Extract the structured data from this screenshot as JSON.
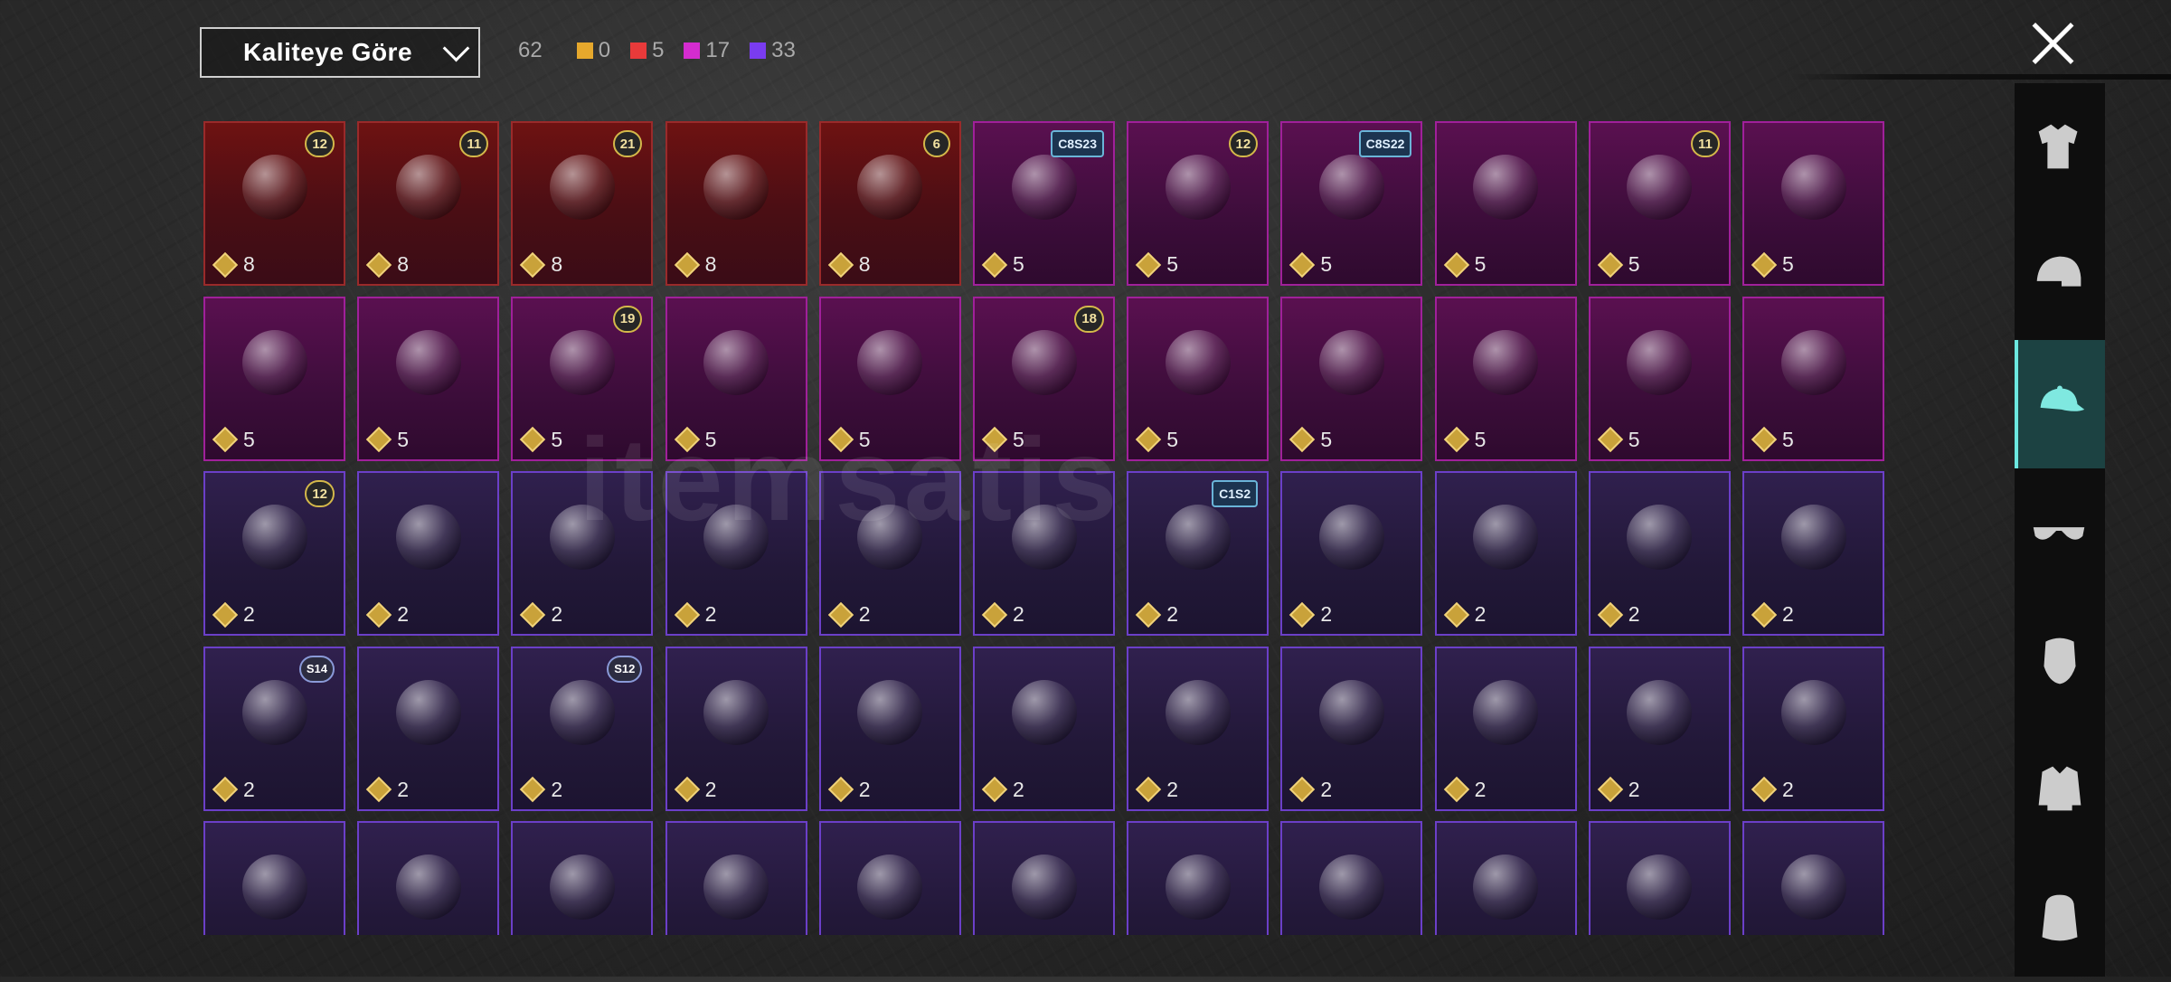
{
  "sort_dropdown": {
    "label": "Kaliteye Göre"
  },
  "quality_counts": {
    "total": "62",
    "items": [
      {
        "color": "#e6a82c",
        "count": "0"
      },
      {
        "color": "#e83a3a",
        "count": "5"
      },
      {
        "color": "#d42ccf",
        "count": "17"
      },
      {
        "color": "#7a3cf0",
        "count": "33"
      }
    ]
  },
  "watermark": "itemsatis",
  "categories": [
    {
      "name": "outfit-icon",
      "active": false
    },
    {
      "name": "helmet-icon",
      "active": false
    },
    {
      "name": "cap-icon",
      "active": true
    },
    {
      "name": "glasses-icon",
      "active": false
    },
    {
      "name": "mask-icon",
      "active": false
    },
    {
      "name": "jacket-icon",
      "active": false
    },
    {
      "name": "backpack-icon",
      "active": false
    }
  ],
  "items": [
    {
      "rarity": "red",
      "badge": "12",
      "badge_type": "num",
      "price": "8"
    },
    {
      "rarity": "red",
      "badge": "11",
      "badge_type": "num",
      "price": "8"
    },
    {
      "rarity": "red",
      "badge": "21",
      "badge_type": "num",
      "price": "8"
    },
    {
      "rarity": "red",
      "badge": "",
      "badge_type": "none",
      "price": "8"
    },
    {
      "rarity": "red",
      "badge": "6",
      "badge_type": "num",
      "price": "8"
    },
    {
      "rarity": "pink",
      "badge": "C8S23",
      "badge_type": "season",
      "price": "5"
    },
    {
      "rarity": "pink",
      "badge": "12",
      "badge_type": "num",
      "price": "5"
    },
    {
      "rarity": "pink",
      "badge": "C8S22",
      "badge_type": "season",
      "price": "5"
    },
    {
      "rarity": "pink",
      "badge": "",
      "badge_type": "none",
      "price": "5"
    },
    {
      "rarity": "pink",
      "badge": "11",
      "badge_type": "num",
      "price": "5"
    },
    {
      "rarity": "pink",
      "badge": "",
      "badge_type": "none",
      "price": "5"
    },
    {
      "rarity": "pink",
      "badge": "",
      "badge_type": "none",
      "price": "5"
    },
    {
      "rarity": "pink",
      "badge": "",
      "badge_type": "none",
      "price": "5"
    },
    {
      "rarity": "pink",
      "badge": "19",
      "badge_type": "num",
      "price": "5"
    },
    {
      "rarity": "pink",
      "badge": "",
      "badge_type": "none",
      "price": "5"
    },
    {
      "rarity": "pink",
      "badge": "",
      "badge_type": "none",
      "price": "5"
    },
    {
      "rarity": "pink",
      "badge": "18",
      "badge_type": "num",
      "price": "5"
    },
    {
      "rarity": "pink",
      "badge": "",
      "badge_type": "none",
      "price": "5"
    },
    {
      "rarity": "pink",
      "badge": "",
      "badge_type": "none",
      "price": "5"
    },
    {
      "rarity": "pink",
      "badge": "",
      "badge_type": "none",
      "price": "5"
    },
    {
      "rarity": "pink",
      "badge": "",
      "badge_type": "none",
      "price": "5"
    },
    {
      "rarity": "pink",
      "badge": "",
      "badge_type": "none",
      "price": "5"
    },
    {
      "rarity": "purple",
      "badge": "12",
      "badge_type": "num",
      "price": "2"
    },
    {
      "rarity": "purple",
      "badge": "",
      "badge_type": "none",
      "price": "2"
    },
    {
      "rarity": "purple",
      "badge": "",
      "badge_type": "none",
      "price": "2"
    },
    {
      "rarity": "purple",
      "badge": "",
      "badge_type": "none",
      "price": "2"
    },
    {
      "rarity": "purple",
      "badge": "",
      "badge_type": "none",
      "price": "2"
    },
    {
      "rarity": "purple",
      "badge": "",
      "badge_type": "none",
      "price": "2"
    },
    {
      "rarity": "purple",
      "badge": "C1S2",
      "badge_type": "season",
      "price": "2"
    },
    {
      "rarity": "purple",
      "badge": "",
      "badge_type": "none",
      "price": "2"
    },
    {
      "rarity": "purple",
      "badge": "",
      "badge_type": "none",
      "price": "2"
    },
    {
      "rarity": "purple",
      "badge": "",
      "badge_type": "none",
      "price": "2"
    },
    {
      "rarity": "purple",
      "badge": "",
      "badge_type": "none",
      "price": "2"
    },
    {
      "rarity": "purple",
      "badge": "S14",
      "badge_type": "text",
      "price": "2"
    },
    {
      "rarity": "purple",
      "badge": "",
      "badge_type": "none",
      "price": "2"
    },
    {
      "rarity": "purple",
      "badge": "S12",
      "badge_type": "text",
      "price": "2"
    },
    {
      "rarity": "purple",
      "badge": "",
      "badge_type": "none",
      "price": "2"
    },
    {
      "rarity": "purple",
      "badge": "",
      "badge_type": "none",
      "price": "2"
    },
    {
      "rarity": "purple",
      "badge": "",
      "badge_type": "none",
      "price": "2"
    },
    {
      "rarity": "purple",
      "badge": "",
      "badge_type": "none",
      "price": "2"
    },
    {
      "rarity": "purple",
      "badge": "",
      "badge_type": "none",
      "price": "2"
    },
    {
      "rarity": "purple",
      "badge": "",
      "badge_type": "none",
      "price": "2"
    },
    {
      "rarity": "purple",
      "badge": "",
      "badge_type": "none",
      "price": "2"
    },
    {
      "rarity": "purple",
      "badge": "",
      "badge_type": "none",
      "price": "2"
    },
    {
      "rarity": "purple",
      "badge": "",
      "badge_type": "none",
      "price": ""
    },
    {
      "rarity": "purple",
      "badge": "",
      "badge_type": "none",
      "price": ""
    },
    {
      "rarity": "purple",
      "badge": "",
      "badge_type": "none",
      "price": ""
    },
    {
      "rarity": "purple",
      "badge": "",
      "badge_type": "none",
      "price": ""
    },
    {
      "rarity": "purple",
      "badge": "",
      "badge_type": "none",
      "price": ""
    },
    {
      "rarity": "purple",
      "badge": "",
      "badge_type": "none",
      "price": ""
    },
    {
      "rarity": "purple",
      "badge": "",
      "badge_type": "none",
      "price": ""
    },
    {
      "rarity": "purple",
      "badge": "",
      "badge_type": "none",
      "price": ""
    },
    {
      "rarity": "purple",
      "badge": "",
      "badge_type": "none",
      "price": ""
    },
    {
      "rarity": "purple",
      "badge": "",
      "badge_type": "none",
      "price": ""
    },
    {
      "rarity": "purple",
      "badge": "",
      "badge_type": "none",
      "price": ""
    }
  ]
}
